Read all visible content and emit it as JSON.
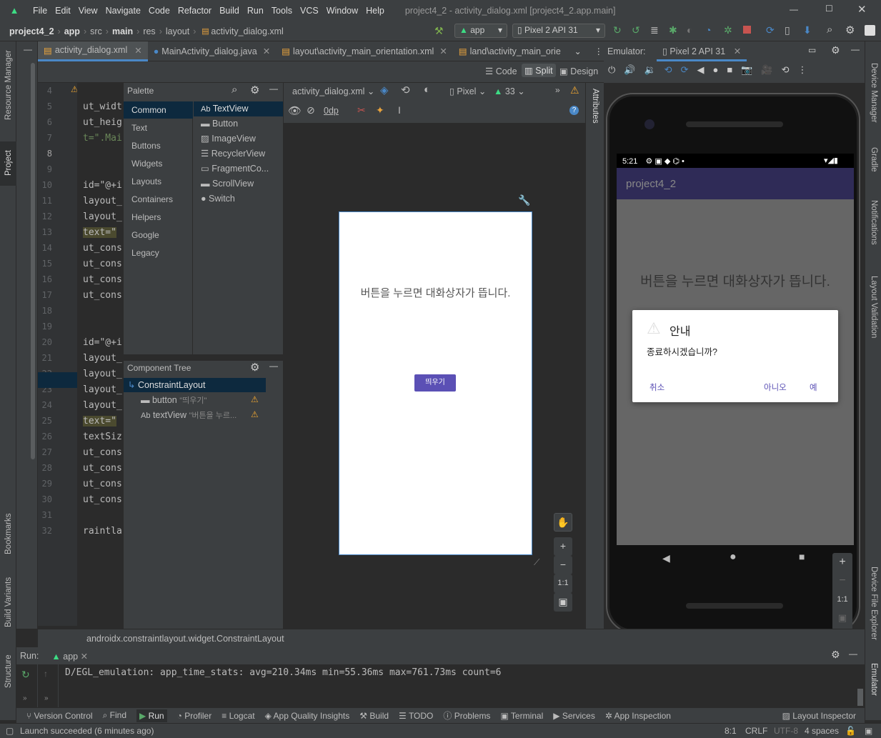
{
  "menu": {
    "items": [
      "File",
      "Edit",
      "View",
      "Navigate",
      "Code",
      "Refactor",
      "Build",
      "Run",
      "Tools",
      "VCS",
      "Window",
      "Help"
    ],
    "window_title": "project4_2 - activity_dialog.xml [project4_2.app.main]"
  },
  "breadcrumb": [
    "project4_2",
    "app",
    "src",
    "main",
    "res",
    "layout",
    "activity_dialog.xml"
  ],
  "toolbar": {
    "run_config": "app",
    "device": "Pixel 2 API 31"
  },
  "editor_tabs": [
    "activity_dialog.xml",
    "MainActivity_dialog.java",
    "layout\\activity_main_orientation.xml",
    "land\\activity_main_orie"
  ],
  "view_modes": {
    "code": "Code",
    "split": "Split",
    "design": "Design"
  },
  "side_left": {
    "resource_manager": "Resource Manager",
    "project": "Project",
    "bookmarks": "Bookmarks",
    "build_variants": "Build Variants",
    "structure": "Structure"
  },
  "side_right": {
    "device_manager": "Device Manager",
    "gradle": "Gradle",
    "notifications": "Notifications",
    "layout_validation": "Layout Validation",
    "device_file_explorer": "Device File Explorer",
    "emulator": "Emulator"
  },
  "code": {
    "warning_count": "2",
    "line_numbers": [
      "4",
      "5",
      "6",
      "7",
      "8",
      "9",
      "10",
      "11",
      "12",
      "13",
      "14",
      "15",
      "16",
      "17",
      "18",
      "19",
      "20",
      "21",
      "22",
      "23",
      "24",
      "25",
      "26",
      "27",
      "28",
      "29",
      "30",
      "31",
      "32"
    ],
    "lines": [
      "",
      "ut_widt",
      "ut_heig",
      "t=\".Mai",
      "",
      "",
      "id=\"@+i",
      "layout_",
      "layout_",
      "text=\"",
      "ut_cons",
      "ut_cons",
      "ut_cons",
      "ut_cons",
      "",
      "",
      "id=\"@+i",
      "layout_",
      "layout_",
      "layout_",
      "layout_",
      "text=\"",
      "textSiz",
      "ut_cons",
      "ut_cons",
      "ut_cons",
      "ut_cons",
      "",
      "raintla"
    ]
  },
  "palette": {
    "title": "Palette",
    "categories": [
      "Common",
      "Text",
      "Buttons",
      "Widgets",
      "Layouts",
      "Containers",
      "Helpers",
      "Google",
      "Legacy"
    ],
    "items": [
      "TextView",
      "Button",
      "ImageView",
      "RecyclerView",
      "FragmentCo...",
      "ScrollView",
      "Switch"
    ]
  },
  "component_tree": {
    "title": "Component Tree",
    "root": "ConstraintLayout",
    "children": [
      {
        "name": "button",
        "text": "\"띄우기\""
      },
      {
        "name": "textView",
        "text": "\"버튼을 누르..."
      }
    ]
  },
  "design_toolbar": {
    "file": "activity_dialog.xml",
    "device": "Pixel",
    "api": "33",
    "margin": "0dp"
  },
  "attributes_label": "Attributes",
  "design_preview": {
    "text": "버튼을 누르면 대화상자가 뜹니다.",
    "button": "띄우기"
  },
  "zoom_controls": {
    "plus": "+",
    "minus": "−",
    "fit": "1:1"
  },
  "emulator": {
    "label": "Emulator:",
    "tab": "Pixel 2 API 31",
    "status_time": "5:21",
    "app_title": "project4_2",
    "main_text": "버튼을 누르면 대화상자가 뜹니다.",
    "dialog": {
      "title": "안내",
      "message": "종료하시겠습니까?",
      "neutral": "취소",
      "negative": "아니오",
      "positive": "예"
    }
  },
  "status_path": "androidx.constraintlayout.widget.ConstraintLayout",
  "run": {
    "label": "Run:",
    "config": "app",
    "log": "D/EGL_emulation: app_time_stats: avg=210.34ms min=55.36ms max=761.73ms count=6"
  },
  "bottom_tools": [
    "Version Control",
    "Find",
    "Run",
    "Profiler",
    "Logcat",
    "App Quality Insights",
    "Build",
    "TODO",
    "Problems",
    "Terminal",
    "Services",
    "App Inspection",
    "Layout Inspector"
  ],
  "statusbar": {
    "message": "Launch succeeded (6 minutes ago)",
    "position": "8:1",
    "line_sep": "CRLF",
    "encoding": "UTF-8",
    "indent": "4 spaces"
  },
  "colors": {
    "accent": "#4a88c7",
    "dialog_button": "#5b50b5",
    "app_bar": "#2f2b57",
    "warning": "#f0a732"
  }
}
